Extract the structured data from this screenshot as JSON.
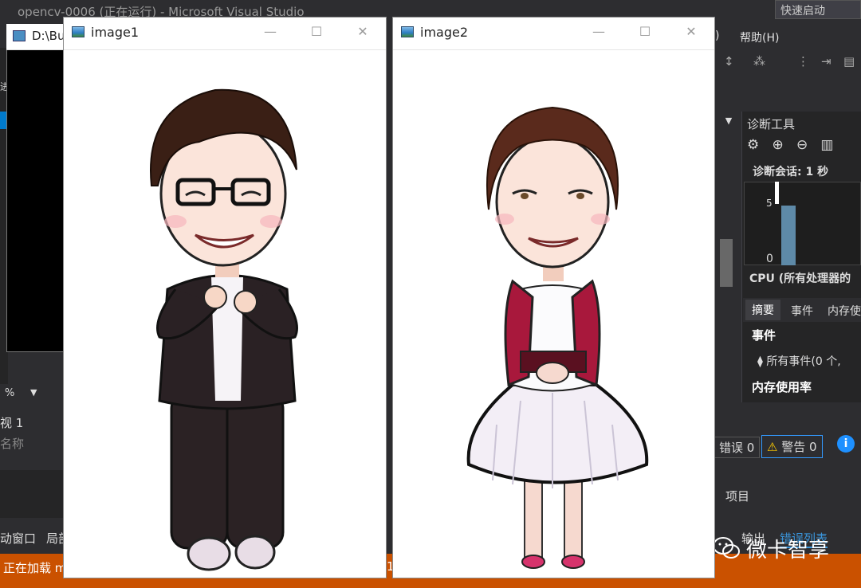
{
  "vs": {
    "title": "opencv-0006 (正在运行) - Microsoft Visual Studio",
    "quick_launch_placeholder": "快速启动",
    "menu_paren": ")",
    "menu_help": "帮助(H)",
    "zoom": "%",
    "view_label": "视 1",
    "name_label": "名称",
    "tab_left_1": "动窗口",
    "tab_left_2": "局部",
    "status": "正在加载 m",
    "status_mid": "1",
    "left_strip_letter": "进"
  },
  "console": {
    "title": "D:\\Bu"
  },
  "diagnostics": {
    "title": "诊断工具",
    "session": "诊断会话: 1 秒",
    "axis_zero": "0",
    "axis_five": "5",
    "cpu_label": "CPU (所有处理器的",
    "tabs": [
      "摘要",
      "事件",
      "内存使"
    ],
    "events_heading": "事件",
    "all_events": "所有事件(0 个,",
    "memory_heading": "内存使用率"
  },
  "error_list": {
    "errors": "错误 0",
    "warnings": "警告 0",
    "project_col": "项目",
    "tab_output": "输出",
    "tab_errors": "错误列表"
  },
  "windows": [
    {
      "title": "image1"
    },
    {
      "title": "image2"
    }
  ],
  "watermark": "微卡智享",
  "colors": {
    "vs_bg": "#2d2d30",
    "status_orange": "#ca5100",
    "accent_blue": "#007acc"
  }
}
